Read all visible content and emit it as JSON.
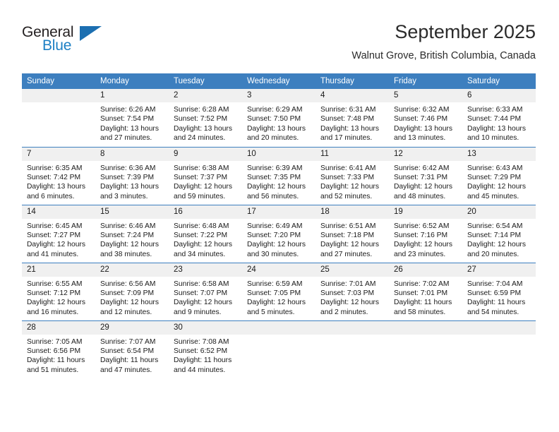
{
  "brand": {
    "name_part1": "General",
    "name_part2": "Blue",
    "accent_color": "#1c7fc4",
    "header_color": "#3d7fbf"
  },
  "header": {
    "month_title": "September 2025",
    "location": "Walnut Grove, British Columbia, Canada"
  },
  "calendar": {
    "weekday_headers": [
      "Sunday",
      "Monday",
      "Tuesday",
      "Wednesday",
      "Thursday",
      "Friday",
      "Saturday"
    ],
    "weeks": [
      [
        {
          "day": "",
          "empty": true,
          "sunrise": "",
          "sunset": "",
          "daylight_line1": "",
          "daylight_line2": ""
        },
        {
          "day": "1",
          "sunrise": "Sunrise: 6:26 AM",
          "sunset": "Sunset: 7:54 PM",
          "daylight_line1": "Daylight: 13 hours",
          "daylight_line2": "and 27 minutes."
        },
        {
          "day": "2",
          "sunrise": "Sunrise: 6:28 AM",
          "sunset": "Sunset: 7:52 PM",
          "daylight_line1": "Daylight: 13 hours",
          "daylight_line2": "and 24 minutes."
        },
        {
          "day": "3",
          "sunrise": "Sunrise: 6:29 AM",
          "sunset": "Sunset: 7:50 PM",
          "daylight_line1": "Daylight: 13 hours",
          "daylight_line2": "and 20 minutes."
        },
        {
          "day": "4",
          "sunrise": "Sunrise: 6:31 AM",
          "sunset": "Sunset: 7:48 PM",
          "daylight_line1": "Daylight: 13 hours",
          "daylight_line2": "and 17 minutes."
        },
        {
          "day": "5",
          "sunrise": "Sunrise: 6:32 AM",
          "sunset": "Sunset: 7:46 PM",
          "daylight_line1": "Daylight: 13 hours",
          "daylight_line2": "and 13 minutes."
        },
        {
          "day": "6",
          "sunrise": "Sunrise: 6:33 AM",
          "sunset": "Sunset: 7:44 PM",
          "daylight_line1": "Daylight: 13 hours",
          "daylight_line2": "and 10 minutes."
        }
      ],
      [
        {
          "day": "7",
          "sunrise": "Sunrise: 6:35 AM",
          "sunset": "Sunset: 7:42 PM",
          "daylight_line1": "Daylight: 13 hours",
          "daylight_line2": "and 6 minutes."
        },
        {
          "day": "8",
          "sunrise": "Sunrise: 6:36 AM",
          "sunset": "Sunset: 7:39 PM",
          "daylight_line1": "Daylight: 13 hours",
          "daylight_line2": "and 3 minutes."
        },
        {
          "day": "9",
          "sunrise": "Sunrise: 6:38 AM",
          "sunset": "Sunset: 7:37 PM",
          "daylight_line1": "Daylight: 12 hours",
          "daylight_line2": "and 59 minutes."
        },
        {
          "day": "10",
          "sunrise": "Sunrise: 6:39 AM",
          "sunset": "Sunset: 7:35 PM",
          "daylight_line1": "Daylight: 12 hours",
          "daylight_line2": "and 56 minutes."
        },
        {
          "day": "11",
          "sunrise": "Sunrise: 6:41 AM",
          "sunset": "Sunset: 7:33 PM",
          "daylight_line1": "Daylight: 12 hours",
          "daylight_line2": "and 52 minutes."
        },
        {
          "day": "12",
          "sunrise": "Sunrise: 6:42 AM",
          "sunset": "Sunset: 7:31 PM",
          "daylight_line1": "Daylight: 12 hours",
          "daylight_line2": "and 48 minutes."
        },
        {
          "day": "13",
          "sunrise": "Sunrise: 6:43 AM",
          "sunset": "Sunset: 7:29 PM",
          "daylight_line1": "Daylight: 12 hours",
          "daylight_line2": "and 45 minutes."
        }
      ],
      [
        {
          "day": "14",
          "sunrise": "Sunrise: 6:45 AM",
          "sunset": "Sunset: 7:27 PM",
          "daylight_line1": "Daylight: 12 hours",
          "daylight_line2": "and 41 minutes."
        },
        {
          "day": "15",
          "sunrise": "Sunrise: 6:46 AM",
          "sunset": "Sunset: 7:24 PM",
          "daylight_line1": "Daylight: 12 hours",
          "daylight_line2": "and 38 minutes."
        },
        {
          "day": "16",
          "sunrise": "Sunrise: 6:48 AM",
          "sunset": "Sunset: 7:22 PM",
          "daylight_line1": "Daylight: 12 hours",
          "daylight_line2": "and 34 minutes."
        },
        {
          "day": "17",
          "sunrise": "Sunrise: 6:49 AM",
          "sunset": "Sunset: 7:20 PM",
          "daylight_line1": "Daylight: 12 hours",
          "daylight_line2": "and 30 minutes."
        },
        {
          "day": "18",
          "sunrise": "Sunrise: 6:51 AM",
          "sunset": "Sunset: 7:18 PM",
          "daylight_line1": "Daylight: 12 hours",
          "daylight_line2": "and 27 minutes."
        },
        {
          "day": "19",
          "sunrise": "Sunrise: 6:52 AM",
          "sunset": "Sunset: 7:16 PM",
          "daylight_line1": "Daylight: 12 hours",
          "daylight_line2": "and 23 minutes."
        },
        {
          "day": "20",
          "sunrise": "Sunrise: 6:54 AM",
          "sunset": "Sunset: 7:14 PM",
          "daylight_line1": "Daylight: 12 hours",
          "daylight_line2": "and 20 minutes."
        }
      ],
      [
        {
          "day": "21",
          "sunrise": "Sunrise: 6:55 AM",
          "sunset": "Sunset: 7:12 PM",
          "daylight_line1": "Daylight: 12 hours",
          "daylight_line2": "and 16 minutes."
        },
        {
          "day": "22",
          "sunrise": "Sunrise: 6:56 AM",
          "sunset": "Sunset: 7:09 PM",
          "daylight_line1": "Daylight: 12 hours",
          "daylight_line2": "and 12 minutes."
        },
        {
          "day": "23",
          "sunrise": "Sunrise: 6:58 AM",
          "sunset": "Sunset: 7:07 PM",
          "daylight_line1": "Daylight: 12 hours",
          "daylight_line2": "and 9 minutes."
        },
        {
          "day": "24",
          "sunrise": "Sunrise: 6:59 AM",
          "sunset": "Sunset: 7:05 PM",
          "daylight_line1": "Daylight: 12 hours",
          "daylight_line2": "and 5 minutes."
        },
        {
          "day": "25",
          "sunrise": "Sunrise: 7:01 AM",
          "sunset": "Sunset: 7:03 PM",
          "daylight_line1": "Daylight: 12 hours",
          "daylight_line2": "and 2 minutes."
        },
        {
          "day": "26",
          "sunrise": "Sunrise: 7:02 AM",
          "sunset": "Sunset: 7:01 PM",
          "daylight_line1": "Daylight: 11 hours",
          "daylight_line2": "and 58 minutes."
        },
        {
          "day": "27",
          "sunrise": "Sunrise: 7:04 AM",
          "sunset": "Sunset: 6:59 PM",
          "daylight_line1": "Daylight: 11 hours",
          "daylight_line2": "and 54 minutes."
        }
      ],
      [
        {
          "day": "28",
          "sunrise": "Sunrise: 7:05 AM",
          "sunset": "Sunset: 6:56 PM",
          "daylight_line1": "Daylight: 11 hours",
          "daylight_line2": "and 51 minutes."
        },
        {
          "day": "29",
          "sunrise": "Sunrise: 7:07 AM",
          "sunset": "Sunset: 6:54 PM",
          "daylight_line1": "Daylight: 11 hours",
          "daylight_line2": "and 47 minutes."
        },
        {
          "day": "30",
          "sunrise": "Sunrise: 7:08 AM",
          "sunset": "Sunset: 6:52 PM",
          "daylight_line1": "Daylight: 11 hours",
          "daylight_line2": "and 44 minutes."
        },
        {
          "day": "",
          "empty": true,
          "sunrise": "",
          "sunset": "",
          "daylight_line1": "",
          "daylight_line2": ""
        },
        {
          "day": "",
          "empty": true,
          "sunrise": "",
          "sunset": "",
          "daylight_line1": "",
          "daylight_line2": ""
        },
        {
          "day": "",
          "empty": true,
          "sunrise": "",
          "sunset": "",
          "daylight_line1": "",
          "daylight_line2": ""
        },
        {
          "day": "",
          "empty": true,
          "sunrise": "",
          "sunset": "",
          "daylight_line1": "",
          "daylight_line2": ""
        }
      ]
    ]
  }
}
